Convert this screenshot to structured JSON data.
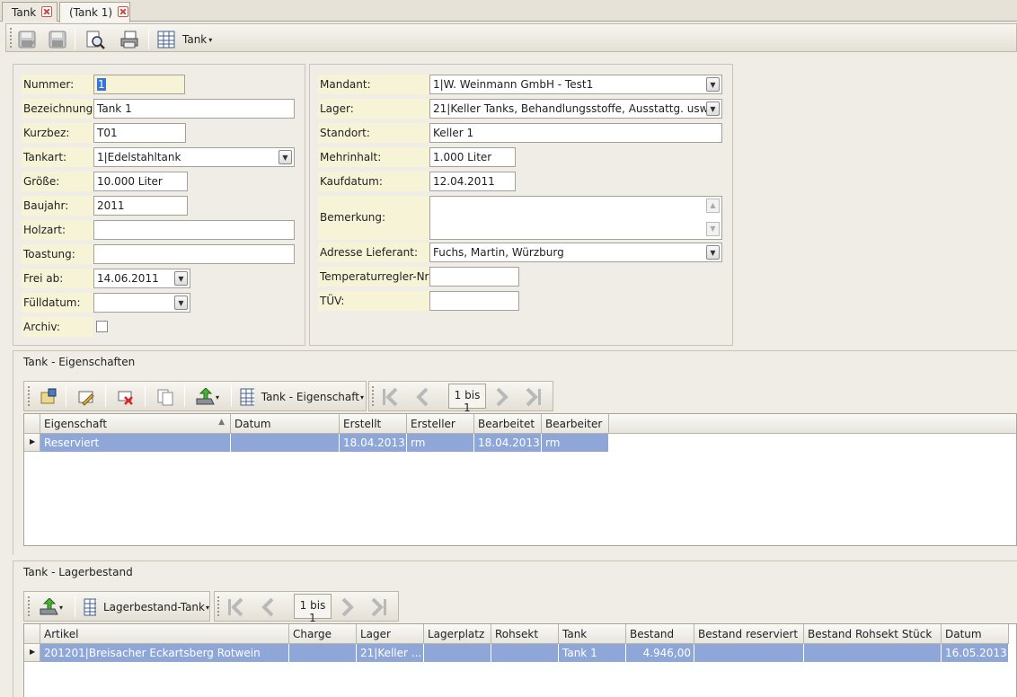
{
  "tabs": [
    {
      "label": "Tank"
    },
    {
      "label": "(Tank 1)"
    }
  ],
  "toolbar": {
    "table_menu_label": "Tank"
  },
  "left_form": {
    "nummer": {
      "label": "Nummer:",
      "value": "1"
    },
    "bezeichnung": {
      "label": "Bezeichnung:",
      "value": "Tank 1"
    },
    "kurzbez": {
      "label": "Kurzbez:",
      "value": "T01"
    },
    "tankart": {
      "label": "Tankart:",
      "value": "1|Edelstahltank"
    },
    "groesse": {
      "label": "Größe:",
      "value": "10.000 Liter"
    },
    "baujahr": {
      "label": "Baujahr:",
      "value": "2011"
    },
    "holzart": {
      "label": "Holzart:",
      "value": ""
    },
    "toastung": {
      "label": "Toastung:",
      "value": ""
    },
    "frei_ab": {
      "label": "Frei ab:",
      "value": "14.06.2011"
    },
    "fuelldatum": {
      "label": "Fülldatum:",
      "value": ""
    },
    "archiv": {
      "label": "Archiv:",
      "checked": false
    }
  },
  "right_form": {
    "mandant": {
      "label": "Mandant:",
      "value": "1|W. Weinmann GmbH - Test1"
    },
    "lager": {
      "label": "Lager:",
      "value": "21|Keller Tanks, Behandlungsstoffe, Ausstattg. usw."
    },
    "standort": {
      "label": "Standort:",
      "value": "Keller 1"
    },
    "mehrinhalt": {
      "label": "Mehrinhalt:",
      "value": "1.000 Liter"
    },
    "kaufdatum": {
      "label": "Kaufdatum:",
      "value": "12.04.2011"
    },
    "bemerkung": {
      "label": "Bemerkung:",
      "value": ""
    },
    "lieferant": {
      "label": "Adresse Lieferant:",
      "value": "Fuchs, Martin, Würzburg"
    },
    "tempregler": {
      "label": "Temperaturregler-Nr:",
      "value": ""
    },
    "tuev": {
      "label": "TÜV:",
      "value": ""
    }
  },
  "eigenschaften": {
    "title": "Tank - Eigenschaften",
    "menu_label": "Tank - Eigenschaft",
    "pager": "1 bis 1",
    "columns": [
      "Eigenschaft",
      "Datum",
      "Erstellt",
      "Ersteller",
      "Bearbeitet",
      "Bearbeiter"
    ],
    "rows": [
      [
        "Reserviert",
        "",
        "18.04.2013",
        "rm",
        "18.04.2013",
        "rm"
      ]
    ]
  },
  "lagerbestand": {
    "title": "Tank - Lagerbestand",
    "menu_label": "Lagerbestand-Tank",
    "pager": "1 bis 1",
    "columns": [
      "Artikel",
      "Charge",
      "Lager",
      "Lagerplatz",
      "Rohsekt",
      "Tank",
      "Bestand",
      "Bestand reserviert",
      "Bestand Rohsekt Stück",
      "Datum"
    ],
    "rows": [
      [
        "201201|Breisacher Eckartsberg Rotwein",
        "",
        "21|Keller ...",
        "",
        "",
        "Tank 1",
        "4.946,00",
        "",
        "",
        "16.05.2013"
      ]
    ]
  },
  "colors": {
    "label_bg": "#f6f3d7",
    "selected_row": "#8ea6d8",
    "background": "#f0ede6"
  }
}
